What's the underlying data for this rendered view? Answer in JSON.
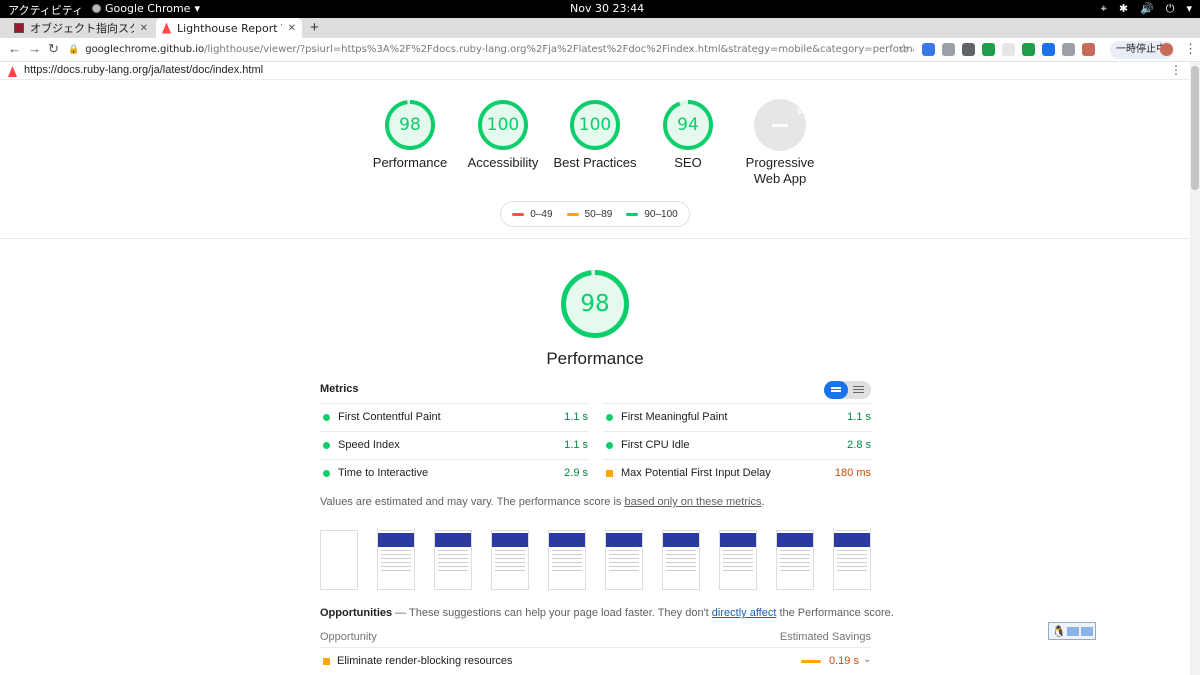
{
  "system_bar": {
    "activities": "アクティビティ",
    "app_name": "Google Chrome",
    "app_caret": "▾",
    "clock": "Nov 30  23:44",
    "tray": [
      "⌖",
      "✱",
      "🔊",
      "⏻",
      "▾"
    ]
  },
  "tabs": [
    {
      "label": "オブジェクト指向スクリプ",
      "close": "✕",
      "active": false
    },
    {
      "label": "Lighthouse Report Viewer",
      "close": "✕",
      "active": true
    }
  ],
  "new_tab": "+",
  "toolbar": {
    "back": "←",
    "forward": "→",
    "reload": "↻",
    "lock": "🔒",
    "url_host": "googlechrome.github.io",
    "url_path": "/lighthouse/viewer/?psiurl=https%3A%2F%2Fdocs.ruby-lang.org%2Fja%2Flatest%2Fdoc%2Findex.html&strategy=mobile&category=performance&category=accessibility&cat...",
    "bookmark": "☆",
    "paused_label": "一時停止中",
    "menu": "⋮",
    "extensions": [
      "#3b78e7",
      "#9aa0a6",
      "#5f6368",
      "#1e9e4a",
      "#e6e6e6",
      "#1e9e4a",
      "#1a73e8",
      "#9aa0a6",
      "#c86a5a"
    ]
  },
  "report_url": {
    "url": "https://docs.ruby-lang.org/ja/latest/doc/index.html",
    "menu": "⋮"
  },
  "gauges": [
    {
      "score": "98",
      "score_value": 98,
      "label": "Performance"
    },
    {
      "score": "100",
      "score_value": 100,
      "label": "Accessibility"
    },
    {
      "score": "100",
      "score_value": 100,
      "label": "Best Practices"
    },
    {
      "score": "94",
      "score_value": 94,
      "label": "SEO"
    }
  ],
  "pwa": {
    "badge": "PWA",
    "label_line1": "Progressive",
    "label_line2": "Web App"
  },
  "legend": [
    {
      "range": "0–49",
      "color": "#ff4e42"
    },
    {
      "range": "50–89",
      "color": "#ffa400"
    },
    {
      "range": "90–100",
      "color": "#0cce6b"
    }
  ],
  "performance": {
    "score": "98",
    "score_value": 98,
    "title": "Performance",
    "colors": {
      "pass": "#0cce6b",
      "average": "#ffa400",
      "fail": "#ff4e42"
    }
  },
  "metrics": {
    "heading": "Metrics",
    "left": [
      {
        "name": "First Contentful Paint",
        "value": "1.1 s",
        "status": "pass"
      },
      {
        "name": "Speed Index",
        "value": "1.1 s",
        "status": "pass"
      },
      {
        "name": "Time to Interactive",
        "value": "2.9 s",
        "status": "pass"
      }
    ],
    "right": [
      {
        "name": "First Meaningful Paint",
        "value": "1.1 s",
        "status": "pass"
      },
      {
        "name": "First CPU Idle",
        "value": "2.8 s",
        "status": "pass"
      },
      {
        "name": "Max Potential First Input Delay",
        "value": "180 ms",
        "status": "average"
      }
    ],
    "note_prefix": "Values are estimated and may vary. The performance score is ",
    "note_link": "based only on these metrics",
    "note_suffix": "."
  },
  "filmstrip_frames": 10,
  "opportunities": {
    "heading": "Opportunities",
    "desc_prefix": " — These suggestions can help your page load faster. They don't ",
    "desc_link": "directly affect",
    "desc_suffix": " the Performance score.",
    "col_left": "Opportunity",
    "col_right": "Estimated Savings",
    "items": [
      {
        "name": "Eliminate render-blocking resources",
        "savings": "0.19 s",
        "chevron": "⌄"
      }
    ]
  },
  "ime_indicator": "🐧"
}
